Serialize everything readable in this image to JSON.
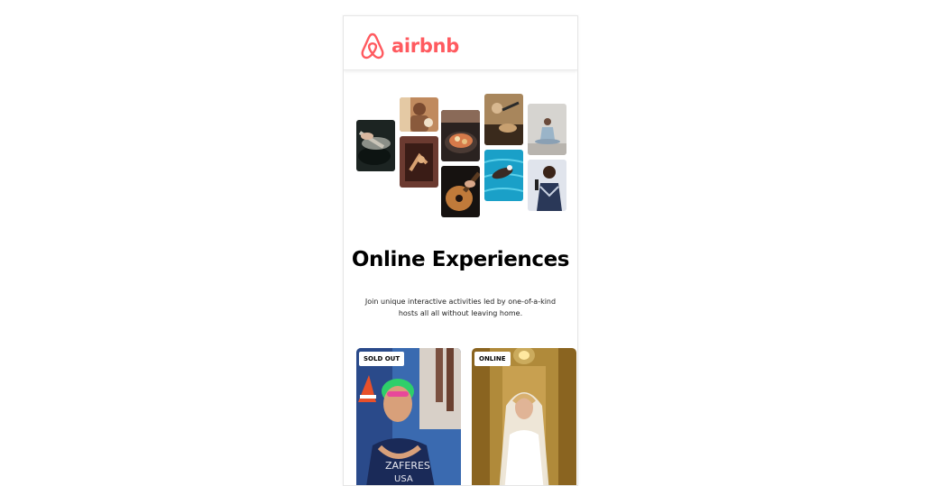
{
  "brand": {
    "name": "airbnb",
    "color": "#ff5a5f"
  },
  "hero": {
    "title": "Online Experiences",
    "subtitle": "Join unique interactive activities led by one-of-a-kind hosts all all without leaving home."
  },
  "gallery": {
    "photos": [
      {
        "name": "cooking-pot-photo"
      },
      {
        "name": "host-portrait-photo"
      },
      {
        "name": "crafting-hands-photo"
      },
      {
        "name": "food-bowl-photo"
      },
      {
        "name": "guitar-playing-photo"
      },
      {
        "name": "workshop-table-photo"
      },
      {
        "name": "swimming-pool-photo"
      },
      {
        "name": "meditation-photo"
      },
      {
        "name": "singer-performer-photo"
      }
    ]
  },
  "cards": [
    {
      "badge": "SOLD OUT",
      "name": "swimmer-experience-card"
    },
    {
      "badge": "ONLINE",
      "name": "bride-experience-card"
    }
  ]
}
